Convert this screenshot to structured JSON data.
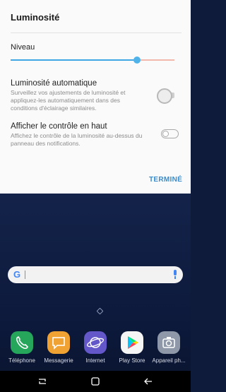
{
  "panel": {
    "title": "Luminosité",
    "level_label": "Niveau",
    "brightness_level": 0.77,
    "auto": {
      "title": "Luminosité automatique",
      "description": "Surveillez vos ajustements de luminosité et appliquez-les automatiquement dans des conditions d'éclairage similaires."
    },
    "show_top": {
      "title": "Afficher le contrôle en haut",
      "description": "Affichez le contrôle de la luminosité au-dessus du panneau des notifications."
    },
    "done_label": "TERMINÉ"
  },
  "search": {
    "google_letter": "G"
  },
  "dock": {
    "apps": [
      {
        "label": "Téléphone",
        "icon": "phone-icon"
      },
      {
        "label": "Messagerie",
        "icon": "message-icon"
      },
      {
        "label": "Internet",
        "icon": "internet-icon"
      },
      {
        "label": "Play Store",
        "icon": "play-store-icon"
      },
      {
        "label": "Appareil ph...",
        "icon": "camera-icon"
      }
    ]
  },
  "colors": {
    "accent": "#3fa7e3",
    "done": "#3a8bc9",
    "wallpaper": "#0f1b3a"
  }
}
